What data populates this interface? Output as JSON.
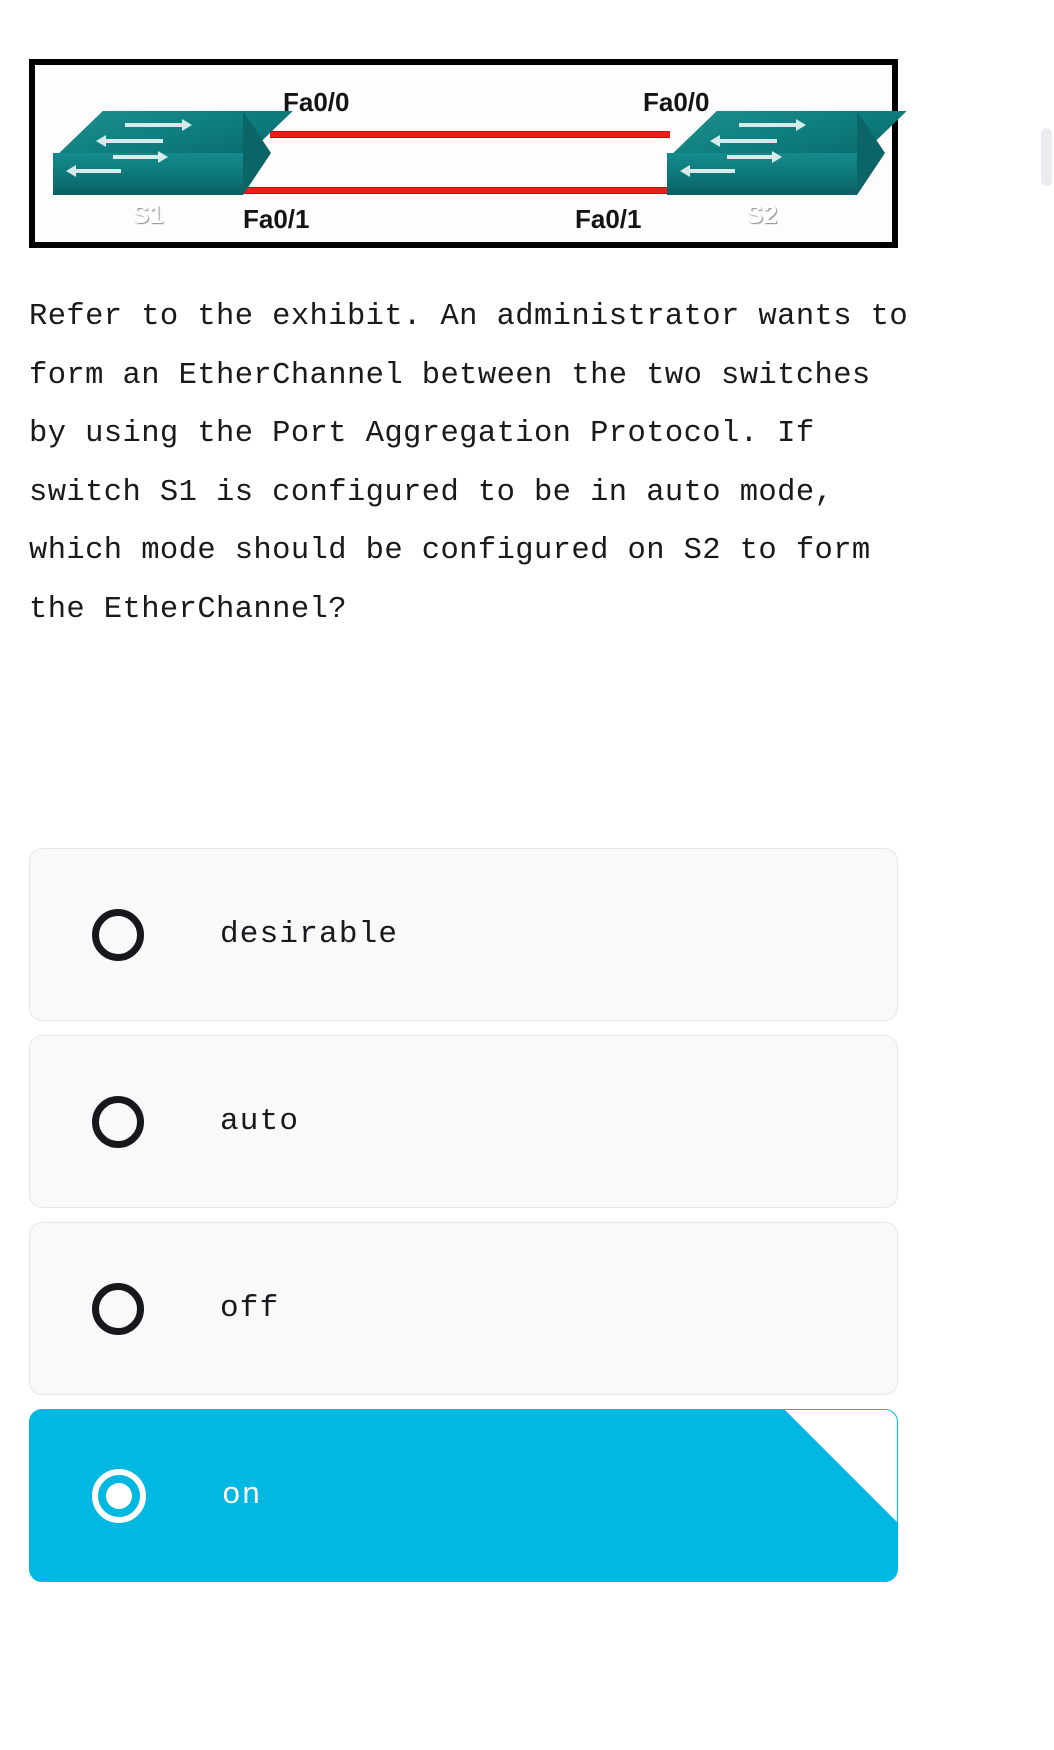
{
  "exhibit": {
    "alt_name": "network-topology-exhibit",
    "devices": [
      {
        "name": "S1",
        "position": "left"
      },
      {
        "name": "S2",
        "position": "right"
      }
    ],
    "links": [
      {
        "label_left": "Fa0/0",
        "label_right": "Fa0/0",
        "color": "#ee1b18",
        "position": "top"
      },
      {
        "label_left": "Fa0/1",
        "label_right": "Fa0/1",
        "color": "#ee1b18",
        "position": "bottom"
      }
    ],
    "port_labels": {
      "s1_top": "Fa0/0",
      "s2_top": "Fa0/0",
      "s1_bottom": "Fa0/1",
      "s2_bottom": "Fa0/1"
    },
    "device_color": "#0f7f80",
    "border_color": "#000000"
  },
  "question": {
    "text": "Refer to the exhibit. An administrator wants to form an EtherChannel between the two switches by using the Port Aggregation Protocol. If switch S1 is configured to be in auto mode, which mode should be configured on S2 to form the EtherChannel?"
  },
  "answers": {
    "selected_index": 3,
    "selected_color": "#00b8e2",
    "unselected_bg": "#f9f9fa",
    "options": [
      {
        "label": "desirable",
        "selected": false
      },
      {
        "label": "auto",
        "selected": false
      },
      {
        "label": "off",
        "selected": false
      },
      {
        "label": "on",
        "selected": true
      }
    ]
  }
}
